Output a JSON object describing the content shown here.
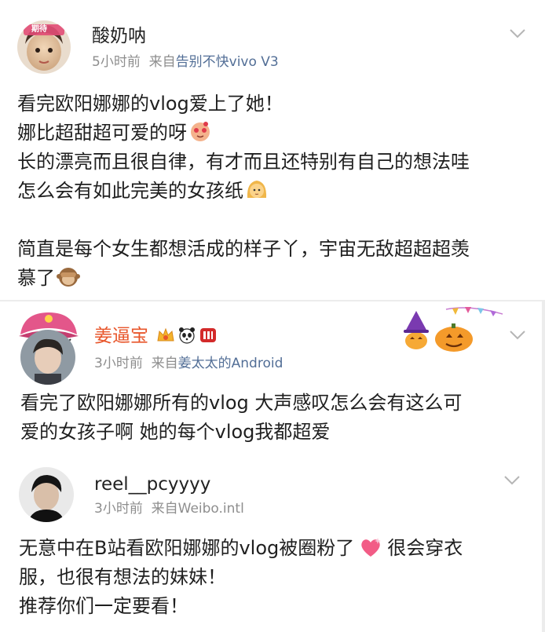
{
  "posts": [
    {
      "username": "酸奶呐",
      "time": "5小时前",
      "from_prefix": "来自",
      "source": "告别不快vivo V3",
      "avatar_badge": "期待",
      "lines": [
        "看完欧阳娜娜的vlog爱上了她！",
        "娜比超甜超可爱的呀",
        "长的漂亮而且很自律，有才而且还特别有自己的想法哇",
        "怎么会有如此完美的女孩纸",
        "",
        "简直是每个女生都想活成的样子丫，宇宙无敌超超超羡",
        "慕了"
      ],
      "icons": [
        "chevron-down-icon",
        "smitten-face-emoji",
        "girl-emoji",
        "see-no-evil-monkey-emoji"
      ]
    },
    {
      "username": "姜逼宝",
      "time": "3小时前",
      "from_prefix": "来自",
      "source": "姜太太的Android",
      "lines": [
        "看完了欧阳娜娜所有的vlog 大声感叹怎么会有这么可",
        "爱的女孩子啊 她的每个vlog我都超爱"
      ],
      "icons": [
        "crown-vip-icon",
        "panda-icon",
        "red-badge-icon",
        "halloween-pumpkin-decoration",
        "pirate-hat-avatar-decoration",
        "chevron-down-icon"
      ],
      "name_color": "#e8562b"
    },
    {
      "username": "reel__pcyyyy",
      "time": "3小时前",
      "from_prefix": "来自",
      "source": "Weibo.intl",
      "lines": [
        "无意中在B站看欧阳娜娜的vlog被圈粉了",
        "服，也很有想法的妹妹！",
        "推荐你们一定要看！"
      ],
      "line1_tail": "很会穿衣",
      "icons": [
        "chevron-down-icon",
        "sparkling-heart-emoji"
      ]
    }
  ]
}
